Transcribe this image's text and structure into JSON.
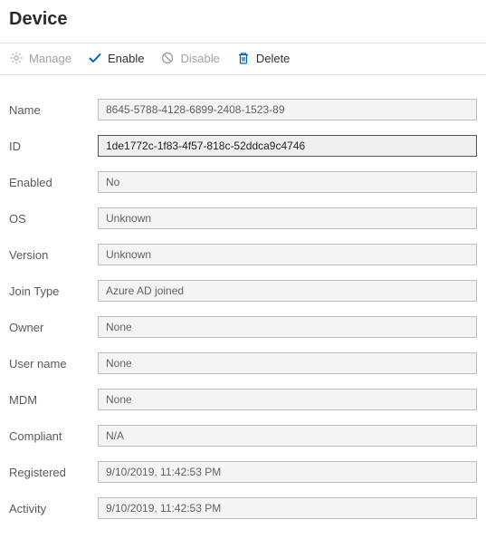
{
  "header": {
    "title": "Device"
  },
  "toolbar": {
    "manage": "Manage",
    "enable": "Enable",
    "disable": "Disable",
    "delete": "Delete"
  },
  "labels": {
    "name": "Name",
    "id": "ID",
    "enabled": "Enabled",
    "os": "OS",
    "version": "Version",
    "joinType": "Join Type",
    "owner": "Owner",
    "userName": "User name",
    "mdm": "MDM",
    "compliant": "Compliant",
    "registered": "Registered",
    "activity": "Activity"
  },
  "values": {
    "name": "8645-5788-4128-6899-2408-1523-89",
    "id": "1de1772c-1f83-4f57-818c-52ddca9c4746",
    "enabled": "No",
    "os": "Unknown",
    "version": "Unknown",
    "joinType": "Azure AD joined",
    "owner": "None",
    "userName": "None",
    "mdm": "None",
    "compliant": "N/A",
    "registered": "9/10/2019, 11:42:53 PM",
    "activity": "9/10/2019, 11:42:53 PM"
  }
}
